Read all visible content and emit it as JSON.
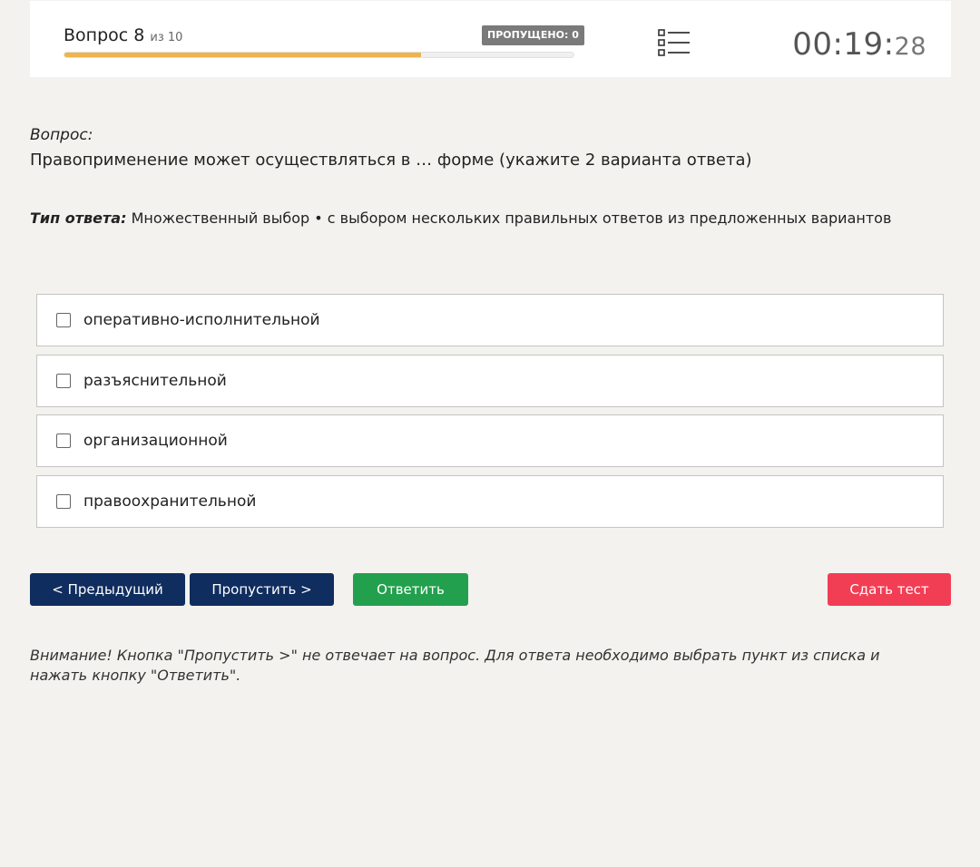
{
  "header": {
    "question_label": "Вопрос 8",
    "question_of": "из 10",
    "skipped_badge": "ПРОПУЩЕНО: 0",
    "progress_fraction": 0.7,
    "timer_main": "00:19:",
    "timer_seconds": "28"
  },
  "question": {
    "label": "Вопрос:",
    "text": "Правоприменение может осуществляться в … форме (укажите 2 варианта ответа)"
  },
  "answer_type": {
    "label": "Тип ответа:",
    "value": "Множественный выбор • с выбором нескольких правильных ответов из предложенных вариантов"
  },
  "options": [
    {
      "label": "оперативно-исполнительной"
    },
    {
      "label": "разъяснительной"
    },
    {
      "label": "организационной"
    },
    {
      "label": "правоохранительной"
    }
  ],
  "buttons": {
    "prev": "< Предыдущий",
    "skip": "Пропустить >",
    "answer": "Ответить",
    "finish": "Сдать тест"
  },
  "note": "Внимание! Кнопка \"Пропустить >\" не отвечает на вопрос. Для ответа необходимо выбрать пункт из списка и нажать кнопку \"Ответить\".",
  "colors": {
    "progress": "#f0b44c",
    "primary": "#0f2d5e",
    "answer": "#23a04e",
    "finish": "#f23e55"
  }
}
